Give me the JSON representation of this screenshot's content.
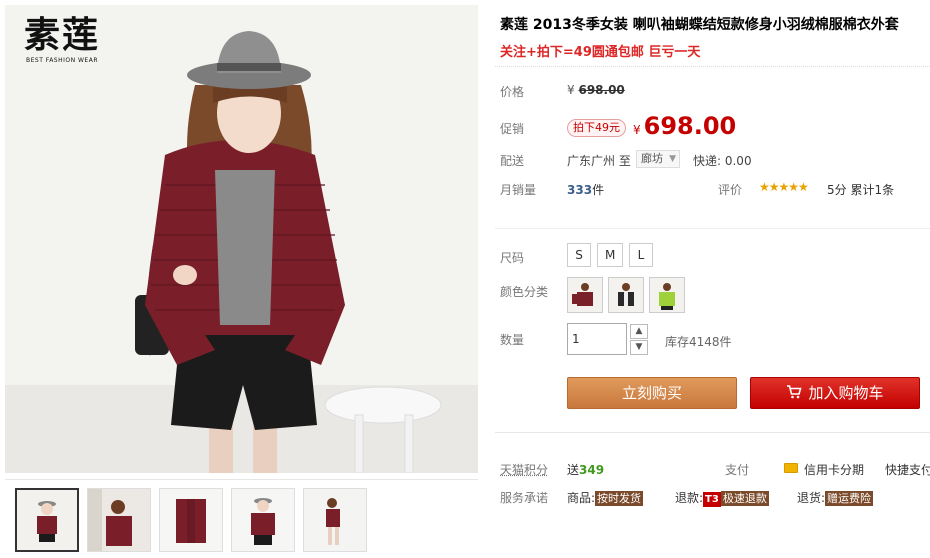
{
  "brand": {
    "logo_cn": "素莲",
    "logo_en": "BEST FASHION WEAR"
  },
  "product": {
    "title": "素莲 2013冬季女装 喇叭袖蝴蝶结短款修身小羽绒棉服棉衣外套",
    "subtitle": "关注+拍下=49圆通包邮 巨亏一天"
  },
  "price": {
    "label": "价格",
    "currency": "¥",
    "original": "698.00",
    "promo_label": "促销",
    "promo_tag": "拍下49元",
    "promo_value": "698.00"
  },
  "delivery": {
    "label": "配送",
    "from": "广东广州",
    "to_word": "至",
    "to_select": "廊坊",
    "fee": "快递: 0.00"
  },
  "sales": {
    "label": "月销量",
    "count": "333",
    "unit": "件",
    "rating_label": "评价",
    "stars": "★★★★★",
    "rating_score": "5分",
    "rating_total": "累计1条"
  },
  "options": {
    "size_label": "尺码",
    "sizes": [
      "S",
      "M",
      "L"
    ],
    "color_label": "颜色分类",
    "colors": [
      "#7a2029",
      "#2a2a2a",
      "#9fd13a"
    ],
    "qty_label": "数量",
    "qty_value": "1",
    "stock": "库存4148件"
  },
  "actions": {
    "buy_now": "立刻购买",
    "add_cart": "加入购物车"
  },
  "extra": {
    "points_label": "天猫积分",
    "points_prefix": "送",
    "points_value": "349",
    "pay_label": "支付",
    "credit_label": "信用卡分期",
    "quick_pay": "快捷支付",
    "service_label": "服务承诺",
    "goods_prefix": "商品:",
    "goods_badge": "按时发货",
    "return_prefix": "退款:",
    "t3_badge": "T3",
    "return_badge": "极速退款",
    "refund_prefix": "退货:",
    "refund_badge": "赠运费险"
  },
  "colors": {
    "promo_red": "#c40000",
    "subtitle_red": "#dd2727",
    "buy_orange": "#d8884b",
    "points_green": "#3f9a1f",
    "star_gold": "#e8a300"
  }
}
